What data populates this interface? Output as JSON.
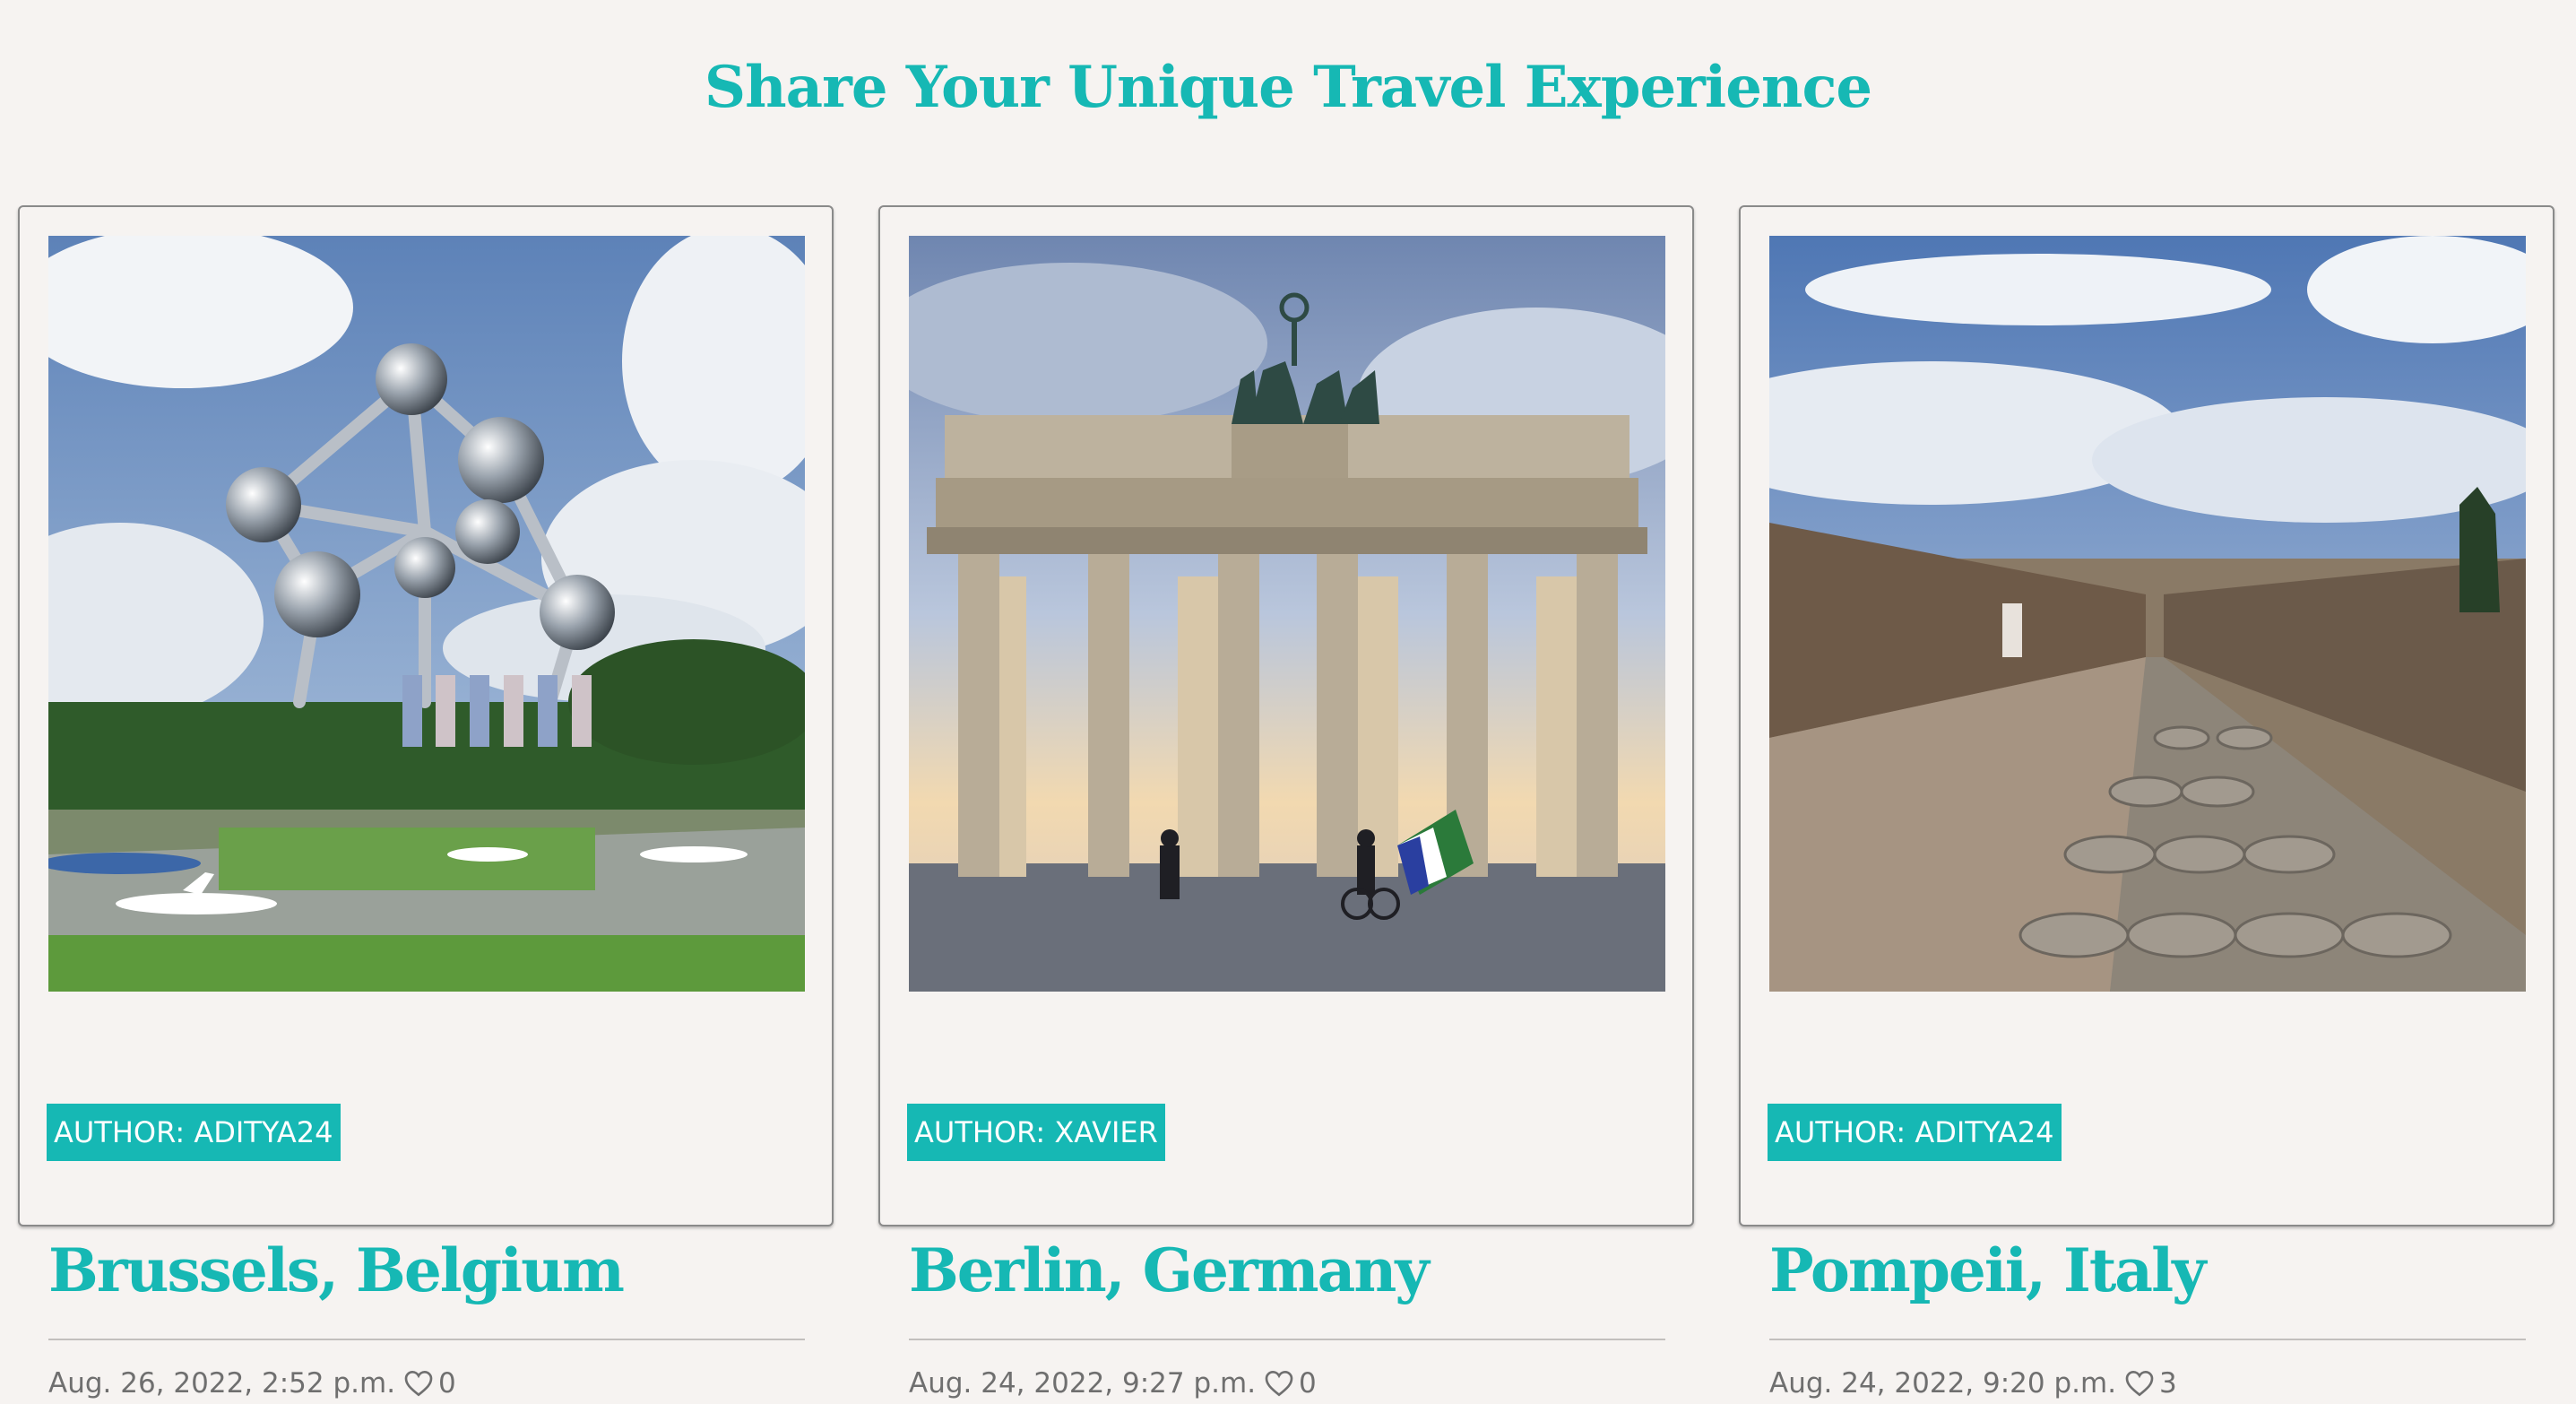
{
  "page": {
    "title": "Share Your Unique Travel Experience"
  },
  "colors": {
    "accent": "#16b8b4",
    "background": "#f6f3f1",
    "meta_text": "#6f6f6f"
  },
  "posts": [
    {
      "title": "Brussels, Belgium",
      "author_label": "AUTHOR: ADITYA24",
      "date": "Aug. 26, 2022, 2:52 p.m.",
      "likes": "0",
      "like_icon": "heart-outline-icon"
    },
    {
      "title": "Berlin, Germany",
      "author_label": "AUTHOR: XAVIER",
      "date": "Aug. 24, 2022, 9:27 p.m.",
      "likes": "0",
      "like_icon": "heart-outline-icon"
    },
    {
      "title": "Pompeii, Italy",
      "author_label": "AUTHOR: ADITYA24",
      "date": "Aug. 24, 2022, 9:20 p.m.",
      "likes": "3",
      "like_icon": "heart-outline-icon"
    }
  ]
}
